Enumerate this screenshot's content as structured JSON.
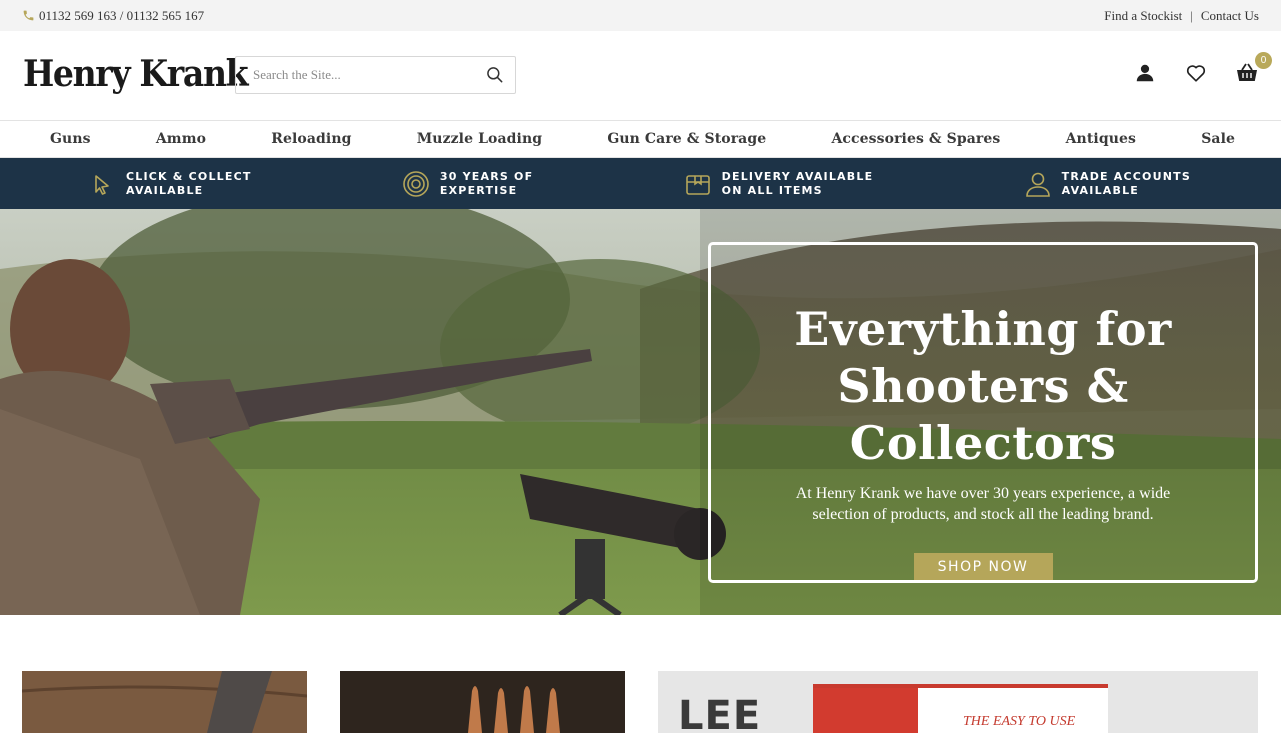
{
  "topbar": {
    "phone": "01132 569 163 / 01132 565 167",
    "find_stockist": "Find a Stockist",
    "separator": "|",
    "contact": "Contact Us"
  },
  "header": {
    "logo": "Henry Krank",
    "search_placeholder": "Search the Site...",
    "cart_count": "0",
    "icons": [
      "account-icon",
      "wishlist-heart-icon",
      "basket-icon",
      "search-icon"
    ]
  },
  "nav": {
    "items": [
      "Guns",
      "Ammo",
      "Reloading",
      "Muzzle Loading",
      "Gun Care & Storage",
      "Accessories & Spares",
      "Antiques",
      "Sale"
    ]
  },
  "usp": {
    "items": [
      {
        "line1": "CLICK & COLLECT",
        "line2": "AVAILABLE",
        "icon": "cursor-icon"
      },
      {
        "line1": "30 YEARS OF",
        "line2": "EXPERTISE",
        "icon": "target-icon"
      },
      {
        "line1": "DELIVERY AVAILABLE",
        "line2": "ON ALL ITEMS",
        "icon": "box-icon"
      },
      {
        "line1": "TRADE ACCOUNTS",
        "line2": "AVAILABLE",
        "icon": "person-icon"
      }
    ]
  },
  "hero": {
    "title_line1": "Everything for",
    "title_line2": "Shooters & Collectors",
    "subtitle": "At Henry Krank we have over 30 years experience, a wide selection of products, and stock all the leading brand.",
    "button": "SHOP NOW"
  },
  "tiles": {
    "tile3_brand": "LEE",
    "tile3_box_text": "THE EASY TO USE"
  },
  "colors": {
    "accent_gold": "#b5a65a",
    "usp_navy": "#1d3347",
    "topbar_bg": "#f3f3f3"
  }
}
